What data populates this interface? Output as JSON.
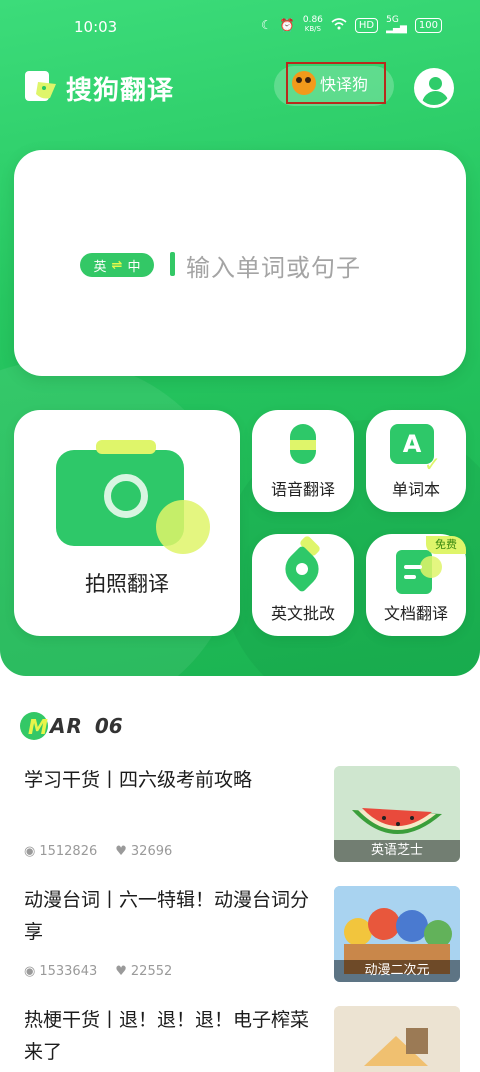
{
  "status_bar": {
    "time": "10:03",
    "network_speed_value": "0.86",
    "network_speed_unit": "KB/S",
    "hd_badge": "HD",
    "signal_label": "5G",
    "battery": "100"
  },
  "header": {
    "app_title": "搜狗翻译",
    "kuaiyigou_label": "快译狗"
  },
  "translate_box": {
    "source_lang": "英",
    "target_lang": "中",
    "swap_symbol": "⇌",
    "placeholder": "输入单词或句子"
  },
  "features": {
    "photo_translate": "拍照翻译",
    "voice_translate": "语音翻译",
    "wordbook": "单词本",
    "wordbook_glyph": "A",
    "english_correction": "英文批改",
    "doc_translate": "文档翻译",
    "free_badge": "免费"
  },
  "date": {
    "month_first": "M",
    "month_rest": "AR",
    "day": "06"
  },
  "articles": [
    {
      "title": "学习干货丨四六级考前攻略",
      "views": "1512826",
      "likes": "32696",
      "thumb_caption": "英语芝士"
    },
    {
      "title": "动漫台词丨六一特辑！动漫台词分享",
      "views": "1533643",
      "likes": "22552",
      "thumb_caption": "动漫二次元"
    },
    {
      "title": "热梗干货丨退！退！退！电子榨菜来了"
    }
  ],
  "colors": {
    "brand_green": "#27c761",
    "accent_yellow": "#dff56a",
    "highlight_border": "#b82a1c"
  }
}
